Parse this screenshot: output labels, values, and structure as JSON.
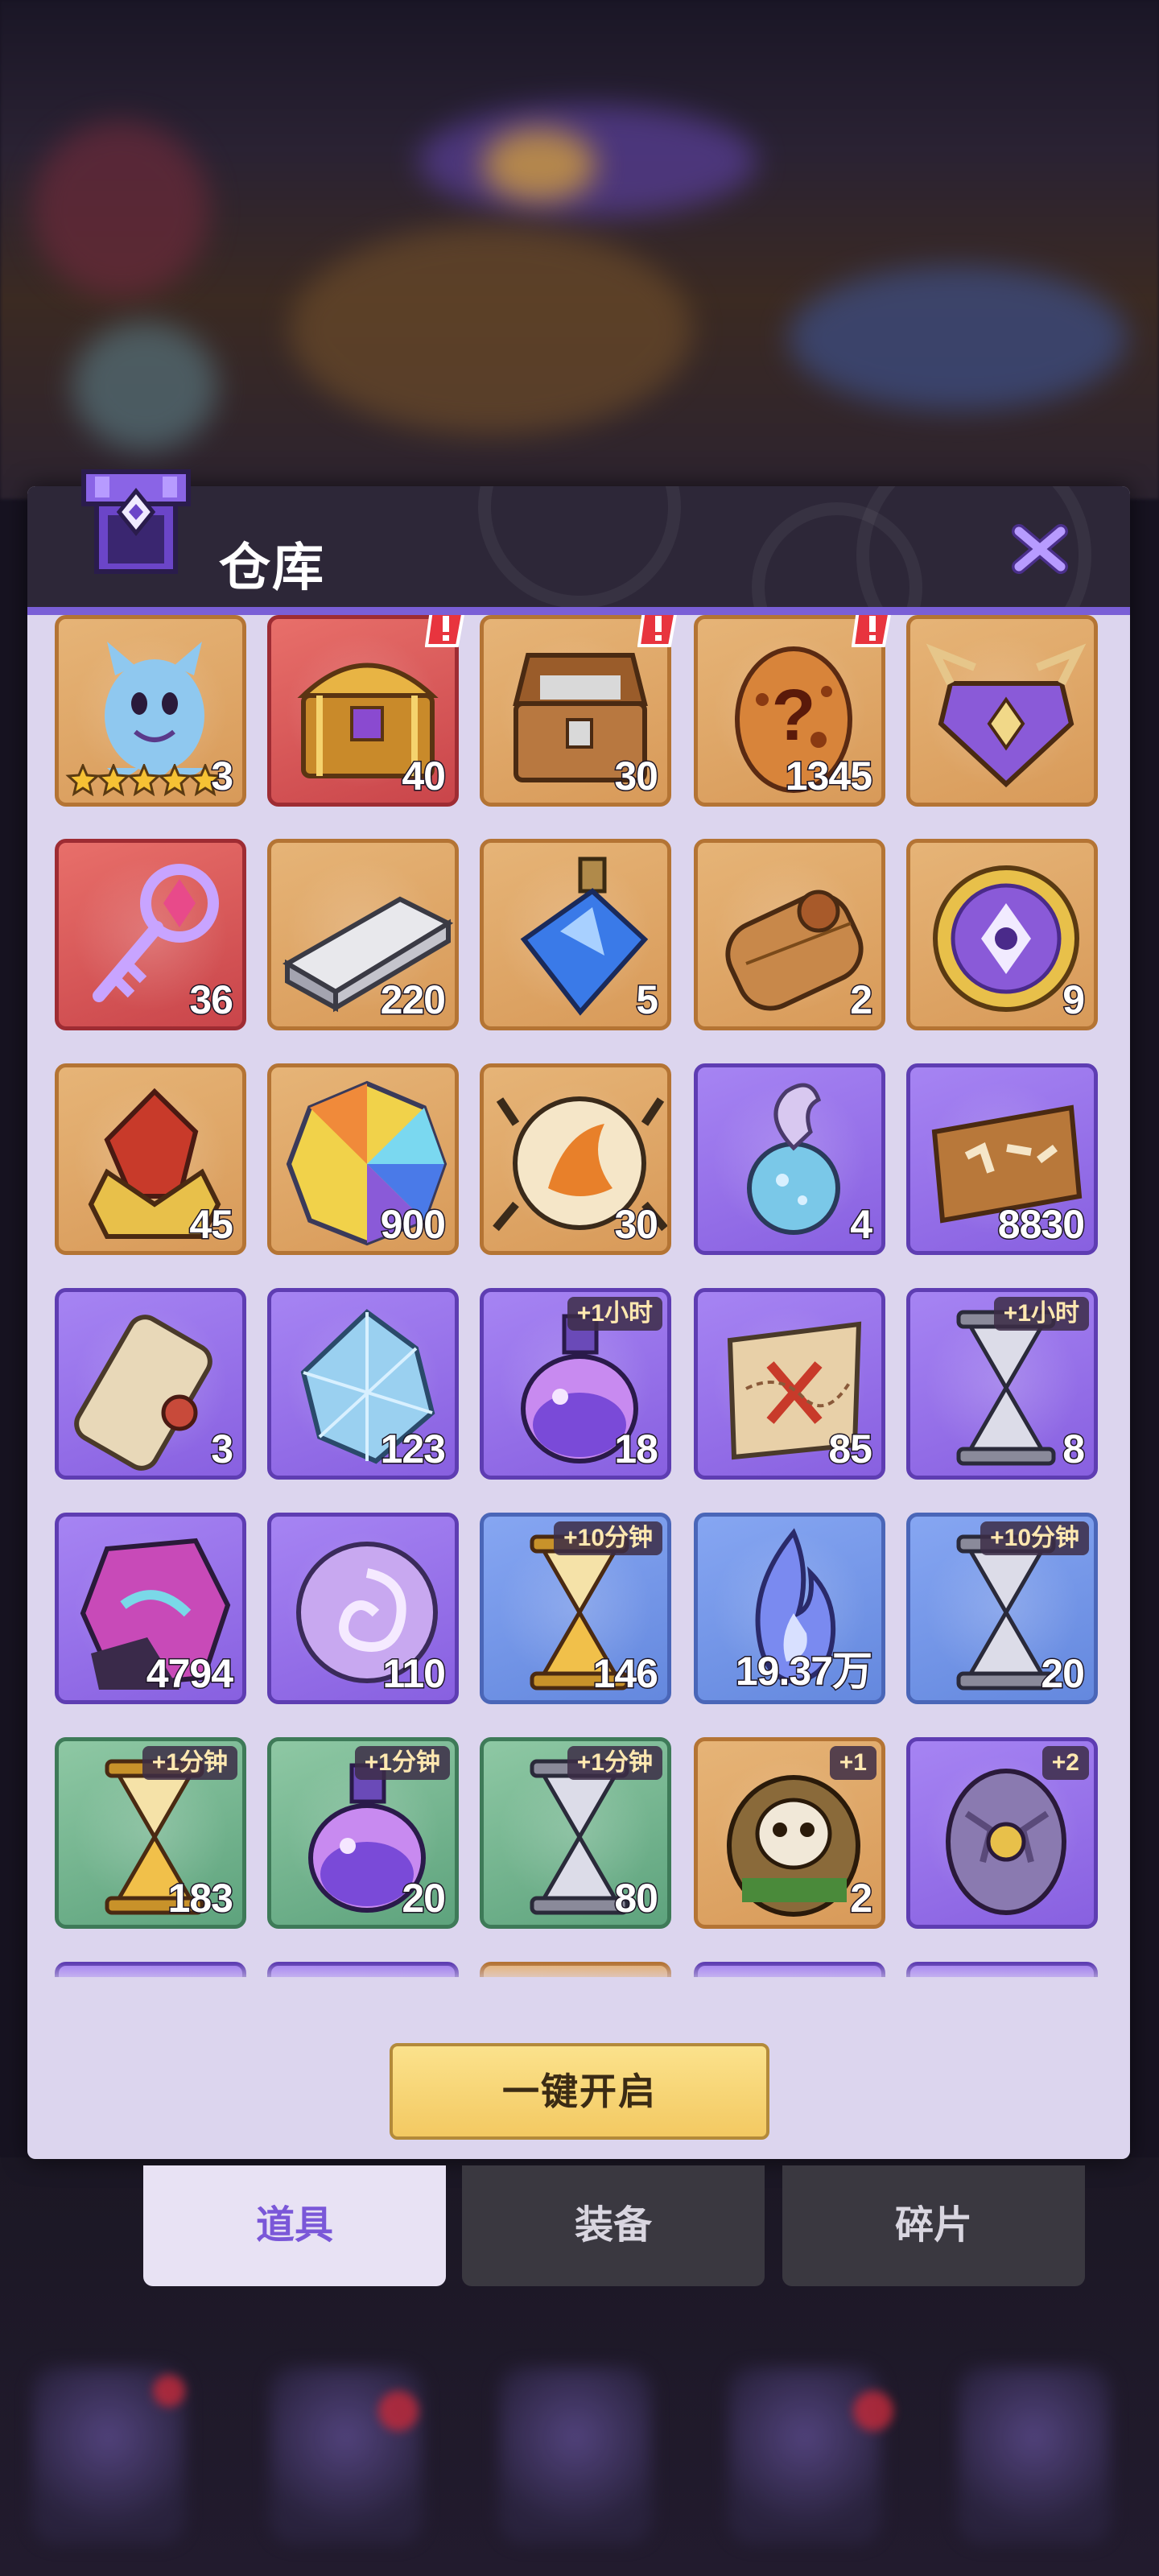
{
  "warehouse": {
    "title": "仓库",
    "open_all_label": "一键开启",
    "tabs": [
      {
        "label": "道具",
        "active": true
      },
      {
        "label": "装备",
        "active": false
      },
      {
        "label": "碎片",
        "active": false
      }
    ],
    "items": [
      {
        "icon": "ghost-hero-icon",
        "frame": "orange",
        "count": "3",
        "stars": 5
      },
      {
        "icon": "golden-treasure-chest-icon",
        "frame": "red",
        "count": "40",
        "alert": true
      },
      {
        "icon": "wooden-treasure-chest-icon",
        "frame": "orange",
        "count": "30",
        "alert": true
      },
      {
        "icon": "mystery-egg-icon",
        "frame": "orange",
        "count": "1345",
        "alert": true
      },
      {
        "icon": "purple-chest-icon",
        "frame": "orange",
        "count": ""
      },
      {
        "icon": "magic-key-icon",
        "frame": "red",
        "count": "36"
      },
      {
        "icon": "silver-ingot-icon",
        "frame": "orange",
        "count": "220"
      },
      {
        "icon": "blue-potion-icon",
        "frame": "orange",
        "count": "5"
      },
      {
        "icon": "scroll-roll-icon",
        "frame": "orange",
        "count": "2"
      },
      {
        "icon": "purple-medallion-icon",
        "frame": "orange",
        "count": "9"
      },
      {
        "icon": "red-crystal-crown-icon",
        "frame": "orange",
        "count": "45"
      },
      {
        "icon": "rainbow-gem-icon",
        "frame": "orange",
        "count": "900"
      },
      {
        "icon": "fire-orb-icon",
        "frame": "orange",
        "count": "30"
      },
      {
        "icon": "soul-flame-drop-icon",
        "frame": "purple",
        "count": "4"
      },
      {
        "icon": "banner-scroll-icon",
        "frame": "purple",
        "count": "8830"
      },
      {
        "icon": "rolled-scroll-icon",
        "frame": "purple",
        "count": "3"
      },
      {
        "icon": "ice-crystal-icon",
        "frame": "purple",
        "count": "123"
      },
      {
        "icon": "potion-flask-icon",
        "frame": "purple",
        "count": "18",
        "tag": "+1小时"
      },
      {
        "icon": "treasure-map-icon",
        "frame": "purple",
        "count": "85"
      },
      {
        "icon": "silver-hourglass-icon",
        "frame": "purple",
        "count": "8",
        "tag": "+1小时"
      },
      {
        "icon": "purple-ore-icon",
        "frame": "purple",
        "count": "4794"
      },
      {
        "icon": "swirl-orb-icon",
        "frame": "purple",
        "count": "110"
      },
      {
        "icon": "golden-hourglass-icon",
        "frame": "blue",
        "count": "146",
        "tag": "+10分钟"
      },
      {
        "icon": "blue-flame-icon",
        "frame": "blue",
        "count": "19.37万"
      },
      {
        "icon": "silver-hourglass-icon",
        "frame": "blue",
        "count": "20",
        "tag": "+10分钟"
      },
      {
        "icon": "golden-hourglass-icon",
        "frame": "green",
        "count": "183",
        "tag": "+1分钟"
      },
      {
        "icon": "potion-flask-icon",
        "frame": "green",
        "count": "20",
        "tag": "+1分钟"
      },
      {
        "icon": "silver-hourglass-icon",
        "frame": "green",
        "count": "80",
        "tag": "+1分钟"
      },
      {
        "icon": "skull-totem-icon",
        "frame": "orange",
        "count": "2",
        "tag": "+1"
      },
      {
        "icon": "rune-egg-icon",
        "frame": "purple",
        "count": "",
        "tag": "+2"
      }
    ]
  }
}
